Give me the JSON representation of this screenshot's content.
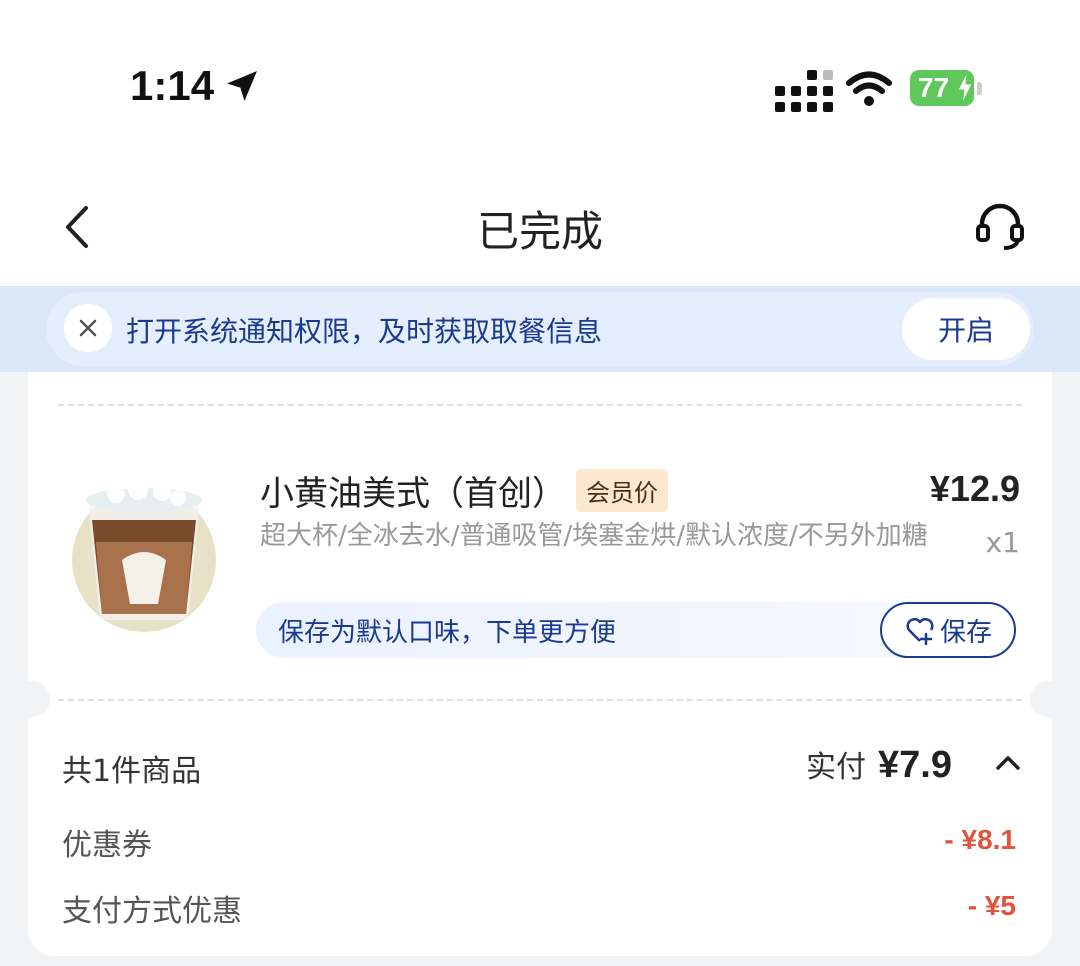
{
  "status_bar": {
    "time": "1:14",
    "battery": "77"
  },
  "nav": {
    "title": "已完成"
  },
  "notice": {
    "text": "打开系统通知权限，及时获取取餐信息",
    "button": "开启"
  },
  "order_item": {
    "name": "小黄油美式（首创）",
    "badge": "会员价",
    "price": "¥12.9",
    "specs": "超大杯/全冰去水/普通吸管/埃塞金烘/默认浓度/不另外加糖",
    "quantity": "x1",
    "save_tip": "保存为默认口味，下单更方便",
    "save_button": "保存"
  },
  "summary": {
    "count_text": "共1件商品",
    "paid_label": "实付",
    "paid_amount": "¥7.9",
    "discounts": [
      {
        "label": "优惠券",
        "value": "- ¥8.1"
      },
      {
        "label": "支付方式优惠",
        "value": "- ¥5"
      }
    ]
  },
  "colors": {
    "accent": "#1a3a8f",
    "discount": "#e0533c",
    "notice_bg": "#dae7fa",
    "badge_bg": "#fbe8cf"
  }
}
